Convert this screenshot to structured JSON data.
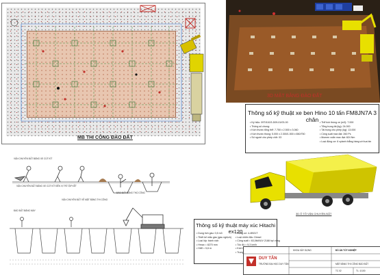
{
  "plan": {
    "caption": "MB THI CÔNG ĐÀO ĐẤT"
  },
  "view3d": {
    "caption": "3D MẶT BẰNG ĐÀO ĐẤT"
  },
  "truck_spec": {
    "title": "Thông số kỹ thuật xe ben Hino 10 tấn FM8JN7A 3 chân",
    "left_lines": [
      "• Ký hiệu: 09T/410/3-D09-01/03-00",
      "• Thông số chung:",
      "• Kích thước tổng thể: 7.750 x 2.500 x 3.060",
      "• Kích thước thùng: 5.000 x 2.300/1.500 x 650/750",
      "• Số người cho phép chở: 03"
    ],
    "right_lines": [
      "• Thể tích thùng xe (m3): 7.000",
      "• Tổng trọng tải (kg): 24.000",
      "• Tải trọng cho phép (kg): 13.000",
      "• Công suất max đạt: 260 Ps",
      "• Momen xoắn max đạt: 824 Nm",
      "• Loại động cơ: 6 xylanh thẳng hàng với tua bin"
    ]
  },
  "truck_caption": "3D Ô TÔ VẬN CHUYỂN ĐẤT",
  "excavator_spec": {
    "title": "Thông số kỹ thuật máy xúc Hitachi ex120",
    "left_lines": [
      "• Dung tích gầu: 0,5 m3",
      "• Thiết kế mẫu gầu (gầu nghịch)",
      "• Loại lốp: bánh xích",
      "• Hmax = 8270 mm",
      "• Hđổ = 5,6 m"
    ],
    "right_lines": [
      "• Động cơ: 4-4BG1T",
      "• Loại nhiên liệu: Diesel",
      "• Công suất = 63,0kW/UV 2188 hp/ vòng",
      "• Tốc độ = 5,3 km/h",
      "• Kích thước = 7580 x 2550 x 2720 mm",
      "• Trọng lượng = 11880 kg"
    ]
  },
  "section_captions": {
    "a": "VẬN CHUYỂN ĐẤT BẰNG XE CÚT KÍT ĐẾN VỊ TRÍ TẬP KẾT",
    "b": "VẬN CHUYỂN ĐẤT BẰNG XE CÚT KÍT",
    "c": "ĐÀO ĐẤT BẰNG THỦ CÔNG",
    "d": "VẬN CHUYỂN ĐẤT VỀ MẶT BẰNG THI CÔNG",
    "e": "ĐÀO ĐẤT BẰNG MÁY"
  },
  "title_block": {
    "company": "DUY TÂN",
    "university": "TRƯỜNG ĐẠI HỌC DUY TÂN",
    "faculty": "KHOA XÂY DỰNG",
    "project_header": "ĐỒ ÁN TỐT NGHIỆP",
    "drawing_title": "MẶT BẰNG THI CÔNG ĐÀO ĐẤT",
    "sheet": "TC 02",
    "scale": "TL: 1/100"
  },
  "colors": {
    "pit": "#e8c6b0",
    "truck": "#e8e000",
    "dim_line": "#2d6fd6",
    "soil": "#7a4a22"
  }
}
